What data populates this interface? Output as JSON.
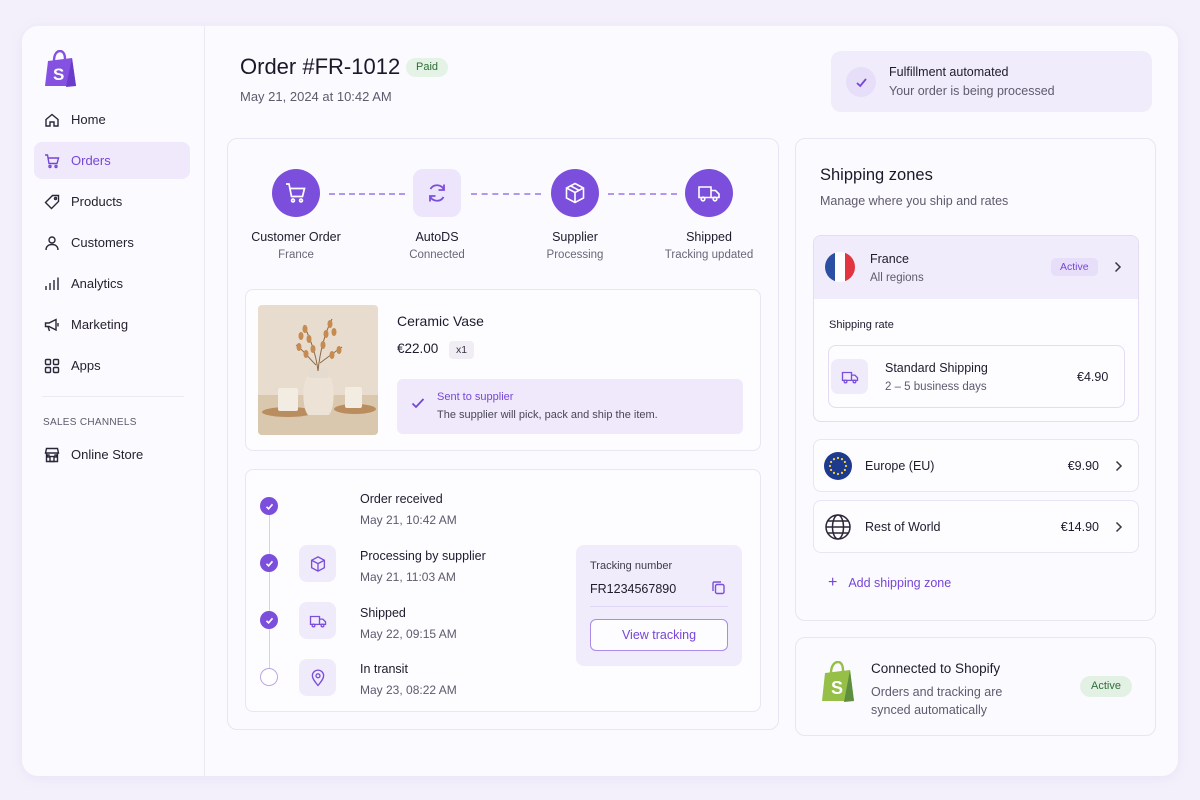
{
  "colors": {
    "accent": "#7b4fdc",
    "paid_green": "#2e6e37",
    "shopify_green": "#95bf47"
  },
  "sidebar": {
    "logo": "shopify-bag-icon",
    "items": [
      {
        "label": "Home",
        "icon": "home-icon",
        "active": false
      },
      {
        "label": "Orders",
        "icon": "cart-icon",
        "active": true
      },
      {
        "label": "Products",
        "icon": "tag-icon",
        "active": false
      },
      {
        "label": "Customers",
        "icon": "user-icon",
        "active": false
      },
      {
        "label": "Analytics",
        "icon": "bar-chart-icon",
        "active": false
      },
      {
        "label": "Marketing",
        "icon": "megaphone-icon",
        "active": false
      },
      {
        "label": "Apps",
        "icon": "apps-grid-icon",
        "active": false
      }
    ],
    "section_title": "SALES CHANNELS",
    "store_item": {
      "label": "Online Store",
      "icon": "store-icon"
    }
  },
  "header": {
    "title": "Order #FR-1012",
    "status_badge": "Paid",
    "date": "May 21, 2024 at 10:42 AM"
  },
  "fulfillment": {
    "title": "Fulfillment automated",
    "subtitle": "Your order is being processed"
  },
  "steps": [
    {
      "label": "Customer Order",
      "sub": "France",
      "icon": "cart-icon"
    },
    {
      "label": "AutoDS",
      "sub": "Connected",
      "icon": "sync-icon"
    },
    {
      "label": "Supplier",
      "sub": "Processing",
      "icon": "box-icon"
    },
    {
      "label": "Shipped",
      "sub": "Tracking updated",
      "icon": "truck-icon"
    }
  ],
  "product": {
    "name": "Ceramic Vase",
    "price": "€22.00",
    "qty": "x1",
    "notice_title": "Sent to supplier",
    "notice_text": "The supplier will pick, pack and ship the item."
  },
  "timeline": [
    {
      "title": "Order received",
      "time": "May 21, 10:42 AM",
      "done": true
    },
    {
      "title": "Processing by supplier",
      "time": "May 21, 11:03 AM",
      "done": true
    },
    {
      "title": "Shipped",
      "time": "May 22, 09:15 AM",
      "done": true
    },
    {
      "title": "In transit",
      "time": "May 23, 08:22 AM",
      "done": false
    }
  ],
  "tracking": {
    "label": "Tracking number",
    "number": "FR1234567890",
    "button": "View tracking"
  },
  "shipping": {
    "title": "Shipping zones",
    "subtitle": "Manage where you ship and rates",
    "france": {
      "name": "France",
      "sub": "All regions",
      "status": "Active"
    },
    "rate_label": "Shipping rate",
    "rate": {
      "name": "Standard Shipping",
      "days": "2 – 5 business days",
      "price": "€4.90"
    },
    "zones": [
      {
        "name": "Europe (EU)",
        "price": "€9.90",
        "icon": "eu-flag-icon"
      },
      {
        "name": "Rest of World",
        "price": "€14.90",
        "icon": "globe-icon"
      }
    ],
    "add_label": "Add shipping zone"
  },
  "connection": {
    "title": "Connected to Shopify",
    "text": "Orders and tracking are synced automatically",
    "status": "Active"
  }
}
